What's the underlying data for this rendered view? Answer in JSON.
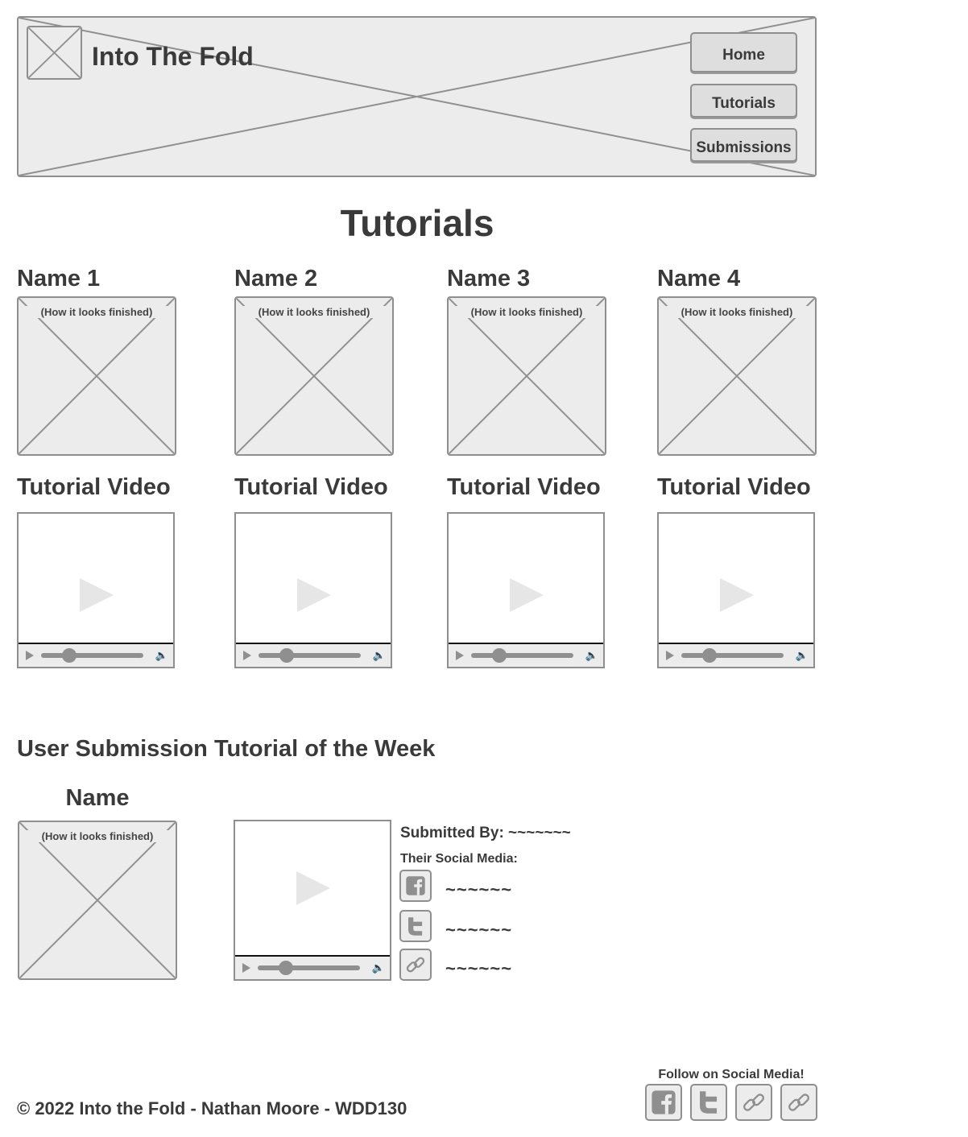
{
  "header": {
    "logo_text": "Into The Fold",
    "nav": [
      {
        "label": "Home"
      },
      {
        "label": "Tutorials"
      },
      {
        "label": "Submissions"
      }
    ]
  },
  "page_title": "Tutorials",
  "tutorials": [
    {
      "name": "Name 1",
      "preview_caption": "(How it looks finished)",
      "video_label": "Tutorial Video"
    },
    {
      "name": "Name 2",
      "preview_caption": "(How it looks finished)",
      "video_label": "Tutorial Video"
    },
    {
      "name": "Name 3",
      "preview_caption": "(How it looks finished)",
      "video_label": "Tutorial Video"
    },
    {
      "name": "Name 4",
      "preview_caption": "(How it looks finished)",
      "video_label": "Tutorial Video"
    }
  ],
  "submission": {
    "title": "User Submission Tutorial of the Week",
    "name": "Name",
    "preview_caption": "(How it looks finished)",
    "submitted_by": "Submitted By: ~~~~~~~",
    "social_heading": "Their Social Media:",
    "social": [
      {
        "icon": "facebook-icon",
        "handle": "~~~~~~"
      },
      {
        "icon": "twitter-icon",
        "handle": "~~~~~~"
      },
      {
        "icon": "link-icon",
        "handle": "~~~~~~"
      }
    ]
  },
  "footer": {
    "copyright": "© 2022 Into the Fold - Nathan Moore - WDD130",
    "follow_label": "Follow on Social Media!",
    "social_icons": [
      "facebook-icon",
      "twitter-icon",
      "link-icon",
      "link-icon"
    ]
  },
  "colors": {
    "placeholder_fill": "#ececec",
    "border": "#8f8f8f",
    "text": "#3a3a3a"
  }
}
